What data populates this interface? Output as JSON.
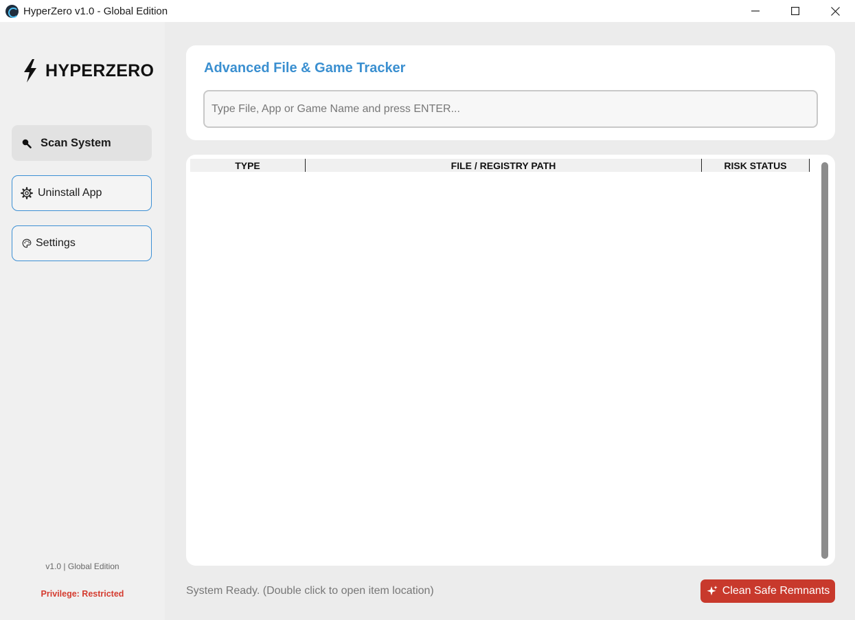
{
  "window": {
    "title": "HyperZero v1.0 - Global Edition"
  },
  "sidebar": {
    "brand": "HYPERZERO",
    "items": [
      {
        "label": "Scan System",
        "icon": "magnifier-icon",
        "active": true
      },
      {
        "label": "Uninstall App",
        "icon": "gear-icon",
        "active": false
      },
      {
        "label": "Settings",
        "icon": "palette-icon",
        "active": false
      }
    ],
    "version": "v1.0 | Global Edition",
    "privilege": "Privilege: Restricted"
  },
  "tracker": {
    "title": "Advanced File & Game Tracker",
    "search_placeholder": "Type File, App or Game Name and press ENTER...",
    "search_value": ""
  },
  "table": {
    "columns": [
      "TYPE",
      "FILE / REGISTRY PATH",
      "RISK STATUS"
    ],
    "rows": []
  },
  "footer": {
    "status": "System Ready. (Double click to open item location)",
    "clean_label": "Clean Safe Remnants"
  },
  "colors": {
    "accent": "#3a8fd0",
    "danger": "#c8392c",
    "privilege_red": "#d43b2f"
  }
}
